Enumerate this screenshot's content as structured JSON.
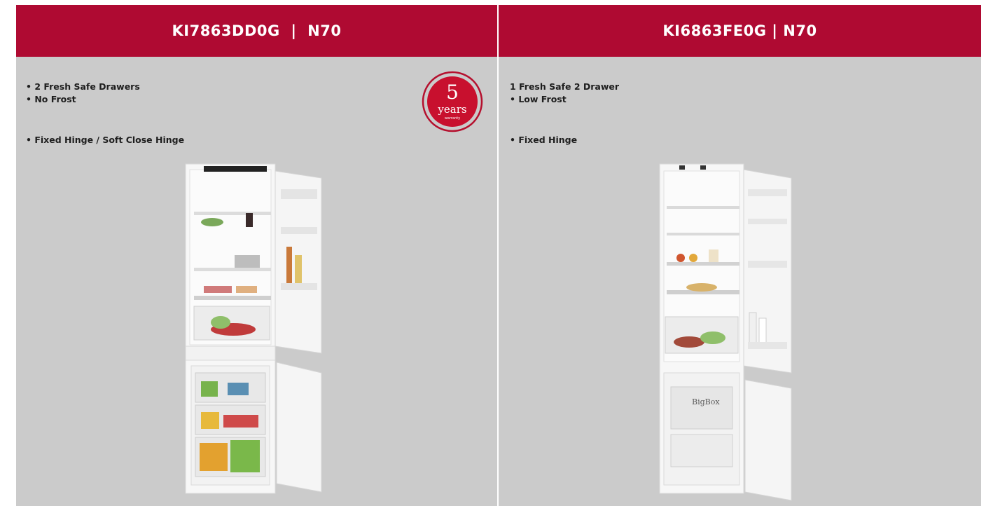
{
  "left": {
    "title_model": "KI7863DD0G",
    "title_sep": "|",
    "title_series": "N70",
    "features": [
      "• 2 Fresh Safe Drawers",
      "• No Frost",
      "• Fixed Hinge / Soft Close Hinge"
    ],
    "badge": {
      "number": "5",
      "unit": "years",
      "caption": "warranty"
    }
  },
  "right": {
    "title_model": "KI6863FE0G",
    "title_sep": "|",
    "title_series": "N70",
    "features": [
      "1 Fresh Safe 2 Drawer",
      "• Low Frost",
      "• Fixed Hinge"
    ],
    "boxlabel": "BigBox"
  },
  "colors": {
    "accent": "#af0a32",
    "panel": "#cbcbcb",
    "text": "#1e1e1e"
  }
}
